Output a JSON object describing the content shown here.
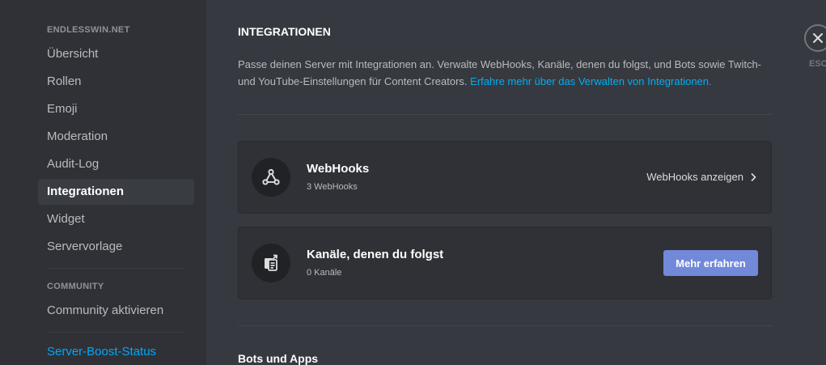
{
  "sidebar": {
    "server_header": "ENDLESSWIN.NET",
    "items": [
      {
        "label": "Übersicht"
      },
      {
        "label": "Rollen"
      },
      {
        "label": "Emoji"
      },
      {
        "label": "Moderation"
      },
      {
        "label": "Audit-Log"
      },
      {
        "label": "Integrationen"
      },
      {
        "label": "Widget"
      },
      {
        "label": "Servervorlage"
      }
    ],
    "active_item": "Integrationen",
    "community_header": "COMMUNITY",
    "community_items": [
      {
        "label": "Community aktivieren"
      }
    ],
    "boost_label": "Server-Boost-Status"
  },
  "main": {
    "title": "INTEGRATIONEN",
    "description": "Passe deinen Server mit Integrationen an. Verwalte WebHooks, Kanäle, denen du folgst, und Bots sowie Twitch- und YouTube-Einstellungen für Content Creators.",
    "learn_more_link": "Erfahre mehr über das Verwalten von Integrationen.",
    "webhooks_card": {
      "title": "WebHooks",
      "subtitle": "3 WebHooks",
      "action_label": "WebHooks anzeigen",
      "icon": "webhook-icon"
    },
    "followed_channels_card": {
      "title": "Kanäle, denen du folgst",
      "subtitle": "0 Kanäle",
      "button_label": "Mehr erfahren",
      "icon": "channel-follow-icon"
    },
    "bots_section_title": "Bots und Apps"
  },
  "close": {
    "label": "ESC",
    "icon": "close-icon"
  },
  "colors": {
    "accent_button": "#7289da",
    "link": "#00aff4",
    "background": "#36393f",
    "sidebar": "#2f3136"
  }
}
